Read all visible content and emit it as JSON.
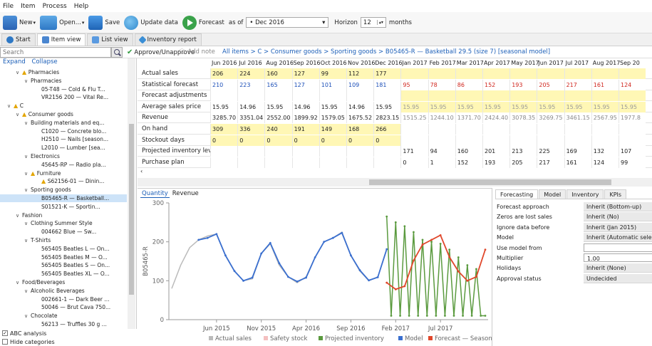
{
  "menu": [
    "File",
    "Item",
    "Process",
    "Help"
  ],
  "toolbar": {
    "new": "New",
    "open": "Open...",
    "save": "Save",
    "update": "Update data",
    "forecast": "Forecast",
    "as_of": "as of",
    "as_of_value": "• Dec 2016",
    "horizon_label": "Horizon",
    "horizon_value": "12",
    "months": "months"
  },
  "tabs": [
    "Start",
    "Item view",
    "List view",
    "Inventory report"
  ],
  "search": {
    "placeholder": "Search",
    "approve": "Approve/Unapprove",
    "add_note": "Add note",
    "breadcrumb": "All items > C > Consumer goods > Sporting goods > B05465-R — Basketball 29.5 (size 7) [seasonal model]"
  },
  "tree": {
    "expand": "Expand",
    "collapse": "Collapse",
    "nodes": [
      {
        "text": "Pharmacies",
        "level": 1,
        "chev": "v",
        "warn": true
      },
      {
        "text": "Pharmacies",
        "level": 2,
        "chev": "v"
      },
      {
        "text": "05-T48 — Cold & Flu T...",
        "level": 4
      },
      {
        "text": "VR2156 200 — Vital Re...",
        "level": 4
      },
      {
        "text": "C",
        "level": 0,
        "chev": "v",
        "warn": true
      },
      {
        "text": "Consumer goods",
        "level": 1,
        "chev": "v",
        "warn": true
      },
      {
        "text": "Building materials and eq...",
        "level": 2,
        "chev": "v"
      },
      {
        "text": "C1020 — Concrete blo...",
        "level": 4
      },
      {
        "text": "H2510 — Nails [season...",
        "level": 4
      },
      {
        "text": "L2010 — Lumber [sea...",
        "level": 4
      },
      {
        "text": "Electronics",
        "level": 2,
        "chev": "v"
      },
      {
        "text": "45645-RP — Radio pla...",
        "level": 4
      },
      {
        "text": "Furniture",
        "level": 2,
        "chev": "v",
        "warn": true
      },
      {
        "text": "S62156-01 — Dinin...",
        "level": 4,
        "warn": true
      },
      {
        "text": "Sporting goods",
        "level": 2,
        "chev": "v"
      },
      {
        "text": "B05465-R — Basketball...",
        "level": 4,
        "selected": true
      },
      {
        "text": "S01521-K — Sportin...",
        "level": 4
      },
      {
        "text": "Fashion",
        "level": 1,
        "chev": "v"
      },
      {
        "text": "Clothing Summer Style",
        "level": 2,
        "chev": "v"
      },
      {
        "text": "004662 Blue — Sw...",
        "level": 4
      },
      {
        "text": "T-Shirts",
        "level": 2,
        "chev": "v"
      },
      {
        "text": "565405 Beatles L — On...",
        "level": 4
      },
      {
        "text": "565405 Beatles M — O...",
        "level": 4
      },
      {
        "text": "565405 Beatles S — On...",
        "level": 4
      },
      {
        "text": "565405 Beatles XL — O...",
        "level": 4
      },
      {
        "text": "Food/Beverages",
        "level": 1,
        "chev": "v"
      },
      {
        "text": "Alcoholic Beverages",
        "level": 2,
        "chev": "v"
      },
      {
        "text": "002661-1 — Dark Beer ...",
        "level": 4
      },
      {
        "text": "50046 — Brut Cava 750...",
        "level": 4
      },
      {
        "text": "Chocolate",
        "level": 2,
        "chev": "v"
      },
      {
        "text": "56213 — Truffles 30 g ...",
        "level": 4
      }
    ],
    "abc_analysis": "ABC analysis",
    "hide_categories": "Hide categories"
  },
  "grid": {
    "columns": [
      "Jun 2016",
      "Jul 2016",
      "Aug 2016",
      "Sep 2016",
      "Oct 2016",
      "Nov 2016",
      "Dec 2016",
      "Jan 2017",
      "Feb 2017",
      "Mar 2017",
      "Apr 2017",
      "May 2017",
      "Jun 2017",
      "Jul 2017",
      "Aug 2017",
      "Sep 20"
    ],
    "rows": [
      {
        "label": "Actual sales",
        "values": [
          "206",
          "224",
          "160",
          "127",
          "99",
          "112",
          "177",
          "",
          "",
          "",
          "",
          "",
          "",
          "",
          "",
          ""
        ]
      },
      {
        "label": "Statistical forecast",
        "values": [
          "210",
          "223",
          "165",
          "127",
          "101",
          "109",
          "181",
          "95",
          "78",
          "86",
          "152",
          "193",
          "205",
          "217",
          "161",
          "124"
        ]
      },
      {
        "label": "Forecast adjustments",
        "values": [
          "",
          "",
          "",
          "",
          "",
          "",
          "",
          "",
          "",
          "",
          "",
          "",
          "",
          "",
          "",
          ""
        ]
      },
      {
        "label": "Average sales price",
        "values": [
          "15.95",
          "14.96",
          "15.95",
          "14.96",
          "15.95",
          "14.96",
          "15.95",
          "15.95",
          "15.95",
          "15.95",
          "15.95",
          "15.95",
          "15.95",
          "15.95",
          "15.95",
          "15.95"
        ]
      },
      {
        "label": "Revenue",
        "values": [
          "3285.70",
          "3351.04",
          "2552.00",
          "1899.92",
          "1579.05",
          "1675.52",
          "2823.15",
          "1515.25",
          "1244.10",
          "1371.70",
          "2424.40",
          "3078.35",
          "3269.75",
          "3461.15",
          "2567.95",
          "1977.8"
        ]
      },
      {
        "label": "On hand",
        "values": [
          "309",
          "336",
          "240",
          "191",
          "149",
          "168",
          "266",
          "",
          "",
          "",
          "",
          "",
          "",
          "",
          "",
          ""
        ]
      },
      {
        "label": "Stockout days",
        "values": [
          "0",
          "0",
          "0",
          "0",
          "0",
          "0",
          "0",
          "",
          "",
          "",
          "",
          "",
          "",
          "",
          "",
          ""
        ]
      },
      {
        "label": "Projected inventory levels",
        "values": [
          "",
          "",
          "",
          "",
          "",
          "",
          "",
          "171",
          "94",
          "160",
          "201",
          "213",
          "225",
          "169",
          "132",
          "107"
        ]
      },
      {
        "label": "Purchase plan",
        "values": [
          "",
          "",
          "",
          "",
          "",
          "",
          "",
          "0",
          "1",
          "152",
          "193",
          "205",
          "217",
          "161",
          "124",
          "99"
        ]
      }
    ]
  },
  "chart_tabs": [
    "Quantity",
    "Revenue"
  ],
  "chart_data": {
    "type": "line",
    "ylabel": "B05465-R",
    "ylim": [
      0,
      300
    ],
    "y_ticks": [
      "0",
      "100",
      "200",
      "300"
    ],
    "x_tick_labels": [
      "Jun 2015",
      "Nov 2015",
      "Apr 2016",
      "Sep 2016",
      "Feb 2017",
      "Jul 2017"
    ],
    "x_tick_months": [
      6,
      11,
      16,
      21,
      26,
      31
    ],
    "colors": {
      "actual": "#bbbbbb",
      "safety": "#f4c0c0",
      "projected": "#5a9a3e",
      "model": "#3a6fcf",
      "forecast": "#e0472b"
    },
    "legend": [
      {
        "label": "Actual sales",
        "color": "#bbbbbb"
      },
      {
        "label": "Safety stock",
        "color": "#f4c0c0"
      },
      {
        "label": "Projected inventory",
        "color": "#5a9a3e"
      },
      {
        "label": "Model",
        "color": "#3a6fcf"
      },
      {
        "label": "Forecast — Seasonal & trend",
        "color": "#e0472b"
      }
    ],
    "series": {
      "actual": {
        "months": [
          1,
          2,
          3,
          4,
          5,
          6,
          7,
          8,
          9,
          10,
          11,
          12,
          13,
          14,
          15,
          16,
          17,
          18,
          19,
          20,
          21,
          22,
          23,
          24
        ],
        "values": [
          80,
          140,
          185,
          205,
          215,
          220,
          165,
          125,
          100,
          105,
          170,
          195,
          140,
          110,
          95,
          110,
          160,
          200,
          210,
          225,
          165,
          125,
          100,
          110
        ]
      },
      "model": {
        "months": [
          4,
          5,
          6,
          7,
          8,
          9,
          10,
          11,
          12,
          13,
          14,
          15,
          16,
          17,
          18,
          19,
          20,
          21,
          22,
          23,
          24,
          25
        ],
        "values": [
          205,
          210,
          220,
          165,
          125,
          100,
          108,
          170,
          197,
          145,
          110,
          98,
          108,
          160,
          200,
          210,
          223,
          165,
          127,
          101,
          109,
          181
        ]
      },
      "forecast": {
        "months": [
          25,
          26,
          27,
          28,
          29,
          30,
          31,
          32,
          33,
          34,
          35,
          36
        ],
        "values": [
          95,
          78,
          86,
          152,
          193,
          205,
          217,
          161,
          124,
          100,
          110,
          180
        ]
      },
      "projected": {
        "x": [
          25,
          25.5,
          26,
          26.5,
          27,
          27.5,
          28,
          28.5,
          29,
          29.5,
          30,
          30.5,
          31,
          31.5,
          32,
          32.5,
          33,
          33.5,
          34,
          34.5,
          35,
          35.5,
          36
        ],
        "values": [
          265,
          10,
          250,
          10,
          240,
          10,
          225,
          10,
          205,
          10,
          200,
          10,
          195,
          10,
          180,
          10,
          160,
          10,
          140,
          10,
          130,
          10,
          10
        ]
      }
    }
  },
  "right_panel": {
    "tabs": [
      "Forecasting",
      "Model",
      "Inventory",
      "KPIs"
    ],
    "props": [
      {
        "label": "Forecast approach",
        "value": "Inherit (Bottom-up)"
      },
      {
        "label": "Zeros are lost sales",
        "value": "Inherit (No)"
      },
      {
        "label": "Ignore data before",
        "value": "Inherit (Jan 2015)"
      },
      {
        "label": "Model",
        "value": "Inherit (Automatic selection)"
      },
      {
        "label": "Use model from",
        "value": "",
        "input": true
      },
      {
        "label": "Multiplier",
        "value": "1.00",
        "input": true
      },
      {
        "label": "Holidays",
        "value": "Inherit (None)"
      },
      {
        "label": "Approval status",
        "value": "Undecided"
      }
    ]
  }
}
